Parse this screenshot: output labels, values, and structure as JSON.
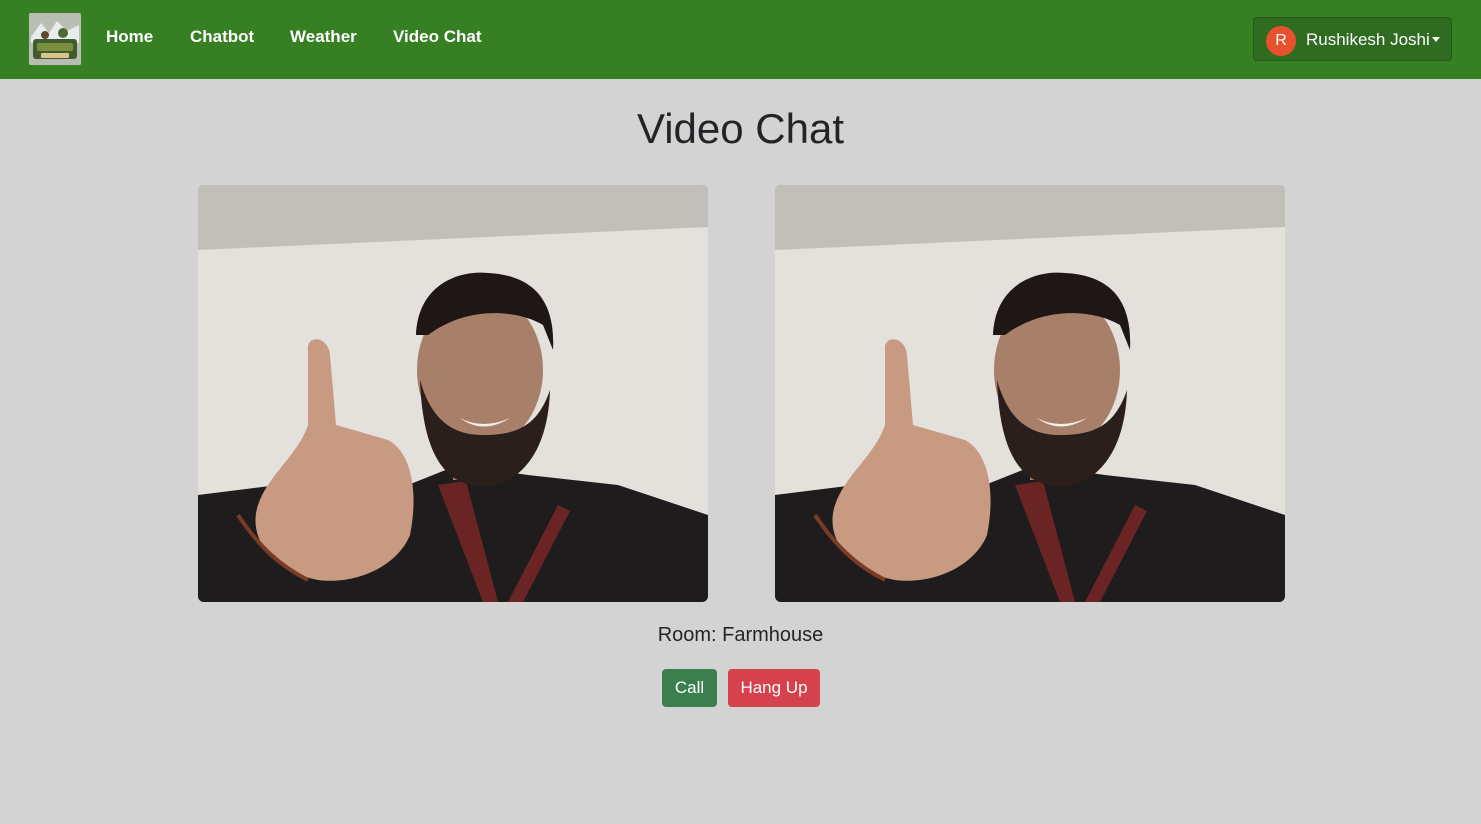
{
  "navbar": {
    "brand_color": "#367f23",
    "logo_icon": "farm-logo-icon",
    "links": [
      {
        "label": "Home"
      },
      {
        "label": "Chatbot"
      },
      {
        "label": "Weather"
      },
      {
        "label": "Video Chat"
      }
    ],
    "user": {
      "avatar_initial": "R",
      "avatar_color": "#e8512d",
      "name": "Rushikesh Joshi",
      "dropdown_icon": "caret-down-icon"
    }
  },
  "main": {
    "title": "Video Chat",
    "videos": [
      {
        "id": "local-video"
      },
      {
        "id": "remote-video"
      }
    ],
    "room_label": "Room: Farmhouse",
    "buttons": {
      "call": {
        "label": "Call",
        "color": "#3b7f4f"
      },
      "hang_up": {
        "label": "Hang Up",
        "color": "#d5414c"
      }
    }
  }
}
